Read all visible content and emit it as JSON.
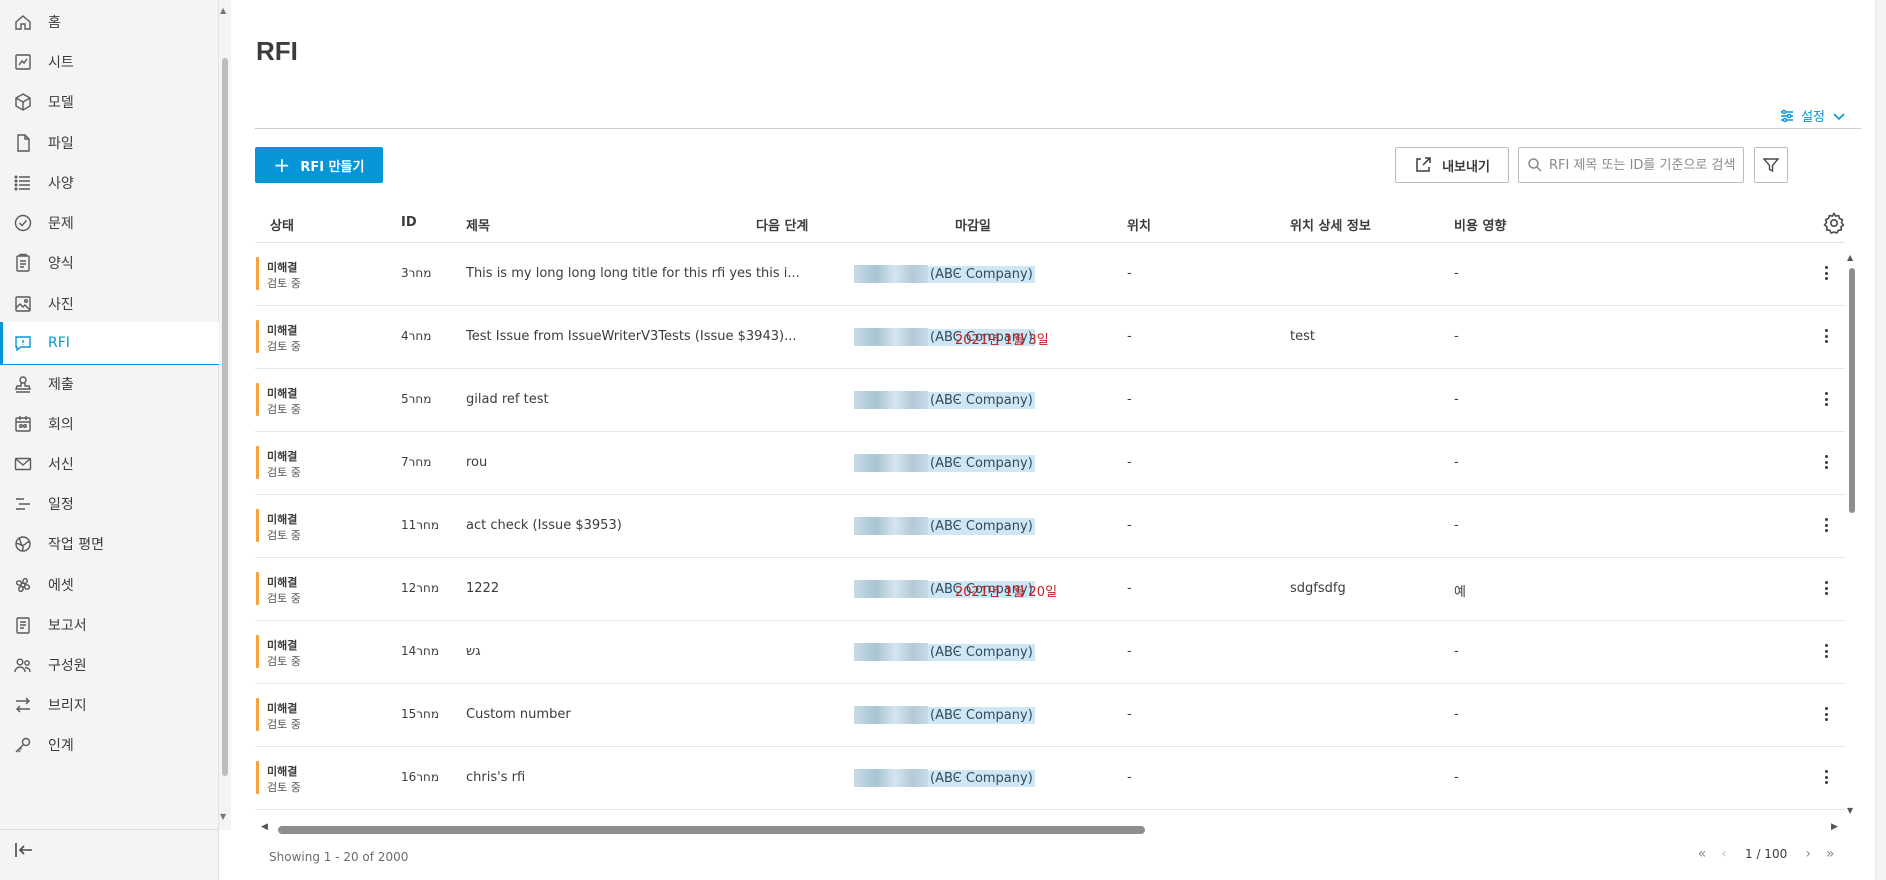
{
  "sidebar": {
    "items": [
      {
        "label": "홈",
        "icon": "home-icon"
      },
      {
        "label": "시트",
        "icon": "sheet-icon"
      },
      {
        "label": "모델",
        "icon": "model-icon"
      },
      {
        "label": "파일",
        "icon": "file-icon"
      },
      {
        "label": "사양",
        "icon": "spec-icon"
      },
      {
        "label": "문제",
        "icon": "issue-icon"
      },
      {
        "label": "양식",
        "icon": "form-icon"
      },
      {
        "label": "사진",
        "icon": "photo-icon"
      },
      {
        "label": "RFI",
        "icon": "rfi-icon",
        "active": true
      },
      {
        "label": "제출",
        "icon": "submittal-icon"
      },
      {
        "label": "회의",
        "icon": "meeting-icon"
      },
      {
        "label": "서신",
        "icon": "mail-icon"
      },
      {
        "label": "일정",
        "icon": "schedule-icon"
      },
      {
        "label": "작업 평면",
        "icon": "workplane-icon"
      },
      {
        "label": "에셋",
        "icon": "asset-icon"
      },
      {
        "label": "보고서",
        "icon": "report-icon"
      },
      {
        "label": "구성원",
        "icon": "members-icon"
      },
      {
        "label": "브리지",
        "icon": "bridge-icon"
      },
      {
        "label": "인계",
        "icon": "handover-icon"
      }
    ]
  },
  "page": {
    "title": "RFI",
    "settings_label": "설정",
    "create_label": "RFI 만들기",
    "export_label": "내보내기",
    "search_placeholder": "RFI 제목 또는 ID를 기준으로 검색"
  },
  "table": {
    "columns": [
      "상태",
      "ID",
      "제목",
      "다음 단계",
      "마감일",
      "위치",
      "위치 상세 정보",
      "비용 영향"
    ],
    "rows": [
      {
        "status": "미해결",
        "substatus": "검토 중",
        "id": "3מחר",
        "title": "This is my long long long title for this rfi yes this i...",
        "next": "(ABC Company)",
        "due": "-",
        "due_overdue": false,
        "location": "-",
        "location_detail": "",
        "cost": "-"
      },
      {
        "status": "미해결",
        "substatus": "검토 중",
        "id": "4מחר",
        "title": "Test Issue from IssueWriterV3Tests (Issue $3943)...",
        "next": "(ABC Company)",
        "due": "2021년 1월 3일",
        "due_overdue": true,
        "location": "-",
        "location_detail": "test",
        "cost": "-"
      },
      {
        "status": "미해결",
        "substatus": "검토 중",
        "id": "5מחר",
        "title": "gilad ref test",
        "next": "(ABC Company)",
        "due": "-",
        "due_overdue": false,
        "location": "-",
        "location_detail": "",
        "cost": "-"
      },
      {
        "status": "미해결",
        "substatus": "검토 중",
        "id": "7מחר",
        "title": "rou",
        "next": "(ABC Company)",
        "due": "-",
        "due_overdue": false,
        "location": "-",
        "location_detail": "",
        "cost": "-"
      },
      {
        "status": "미해결",
        "substatus": "검토 중",
        "id": "11מחר",
        "title": "act check (Issue $3953)",
        "next": "(ABC Company)",
        "due": "-",
        "due_overdue": false,
        "location": "-",
        "location_detail": "",
        "cost": "-"
      },
      {
        "status": "미해결",
        "substatus": "검토 중",
        "id": "12מחר",
        "title": "1222",
        "next": "(ABC Company)",
        "due": "2021년 1월 20일",
        "due_overdue": true,
        "location": "-",
        "location_detail": "sdgfsdfg",
        "cost": "예"
      },
      {
        "status": "미해결",
        "substatus": "검토 중",
        "id": "14מחר",
        "title": "גש",
        "next": "(ABC Company)",
        "due": "-",
        "due_overdue": false,
        "location": "-",
        "location_detail": "",
        "cost": "-"
      },
      {
        "status": "미해결",
        "substatus": "검토 중",
        "id": "15מחר",
        "title": "Custom number",
        "next": "(ABC Company)",
        "due": "-",
        "due_overdue": false,
        "location": "-",
        "location_detail": "",
        "cost": "-"
      },
      {
        "status": "미해결",
        "substatus": "검토 중",
        "id": "16מחר",
        "title": "chris's rfi",
        "next": "(ABC Company)",
        "due": "-",
        "due_overdue": false,
        "location": "-",
        "location_detail": "",
        "cost": "-"
      }
    ]
  },
  "footer": {
    "showing": "Showing 1 - 20 of 2000",
    "page_indicator": "1 / 100"
  },
  "colors": {
    "accent": "#0696d7",
    "status_open": "#f3a33b",
    "overdue": "#c41e1e"
  }
}
